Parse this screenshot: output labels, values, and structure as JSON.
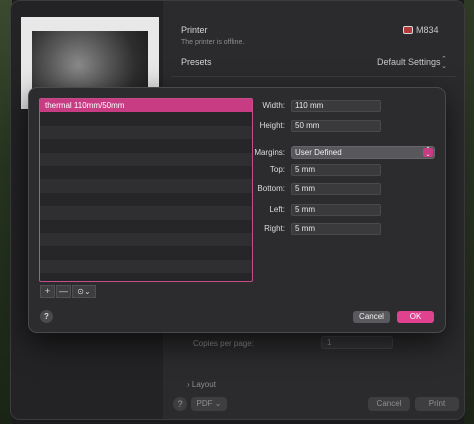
{
  "print_dialog": {
    "printer_label": "Printer",
    "printer_status": "The printer is offline.",
    "printer_name": "M834",
    "presets_label": "Presets",
    "presets_value": "Default Settings",
    "copies_per_page_label": "Copies per page:",
    "copies_per_page_value": "1",
    "layout_label": "Layout",
    "pdf_label": "PDF",
    "cancel_label": "Cancel",
    "print_label": "Print",
    "help_label": "?"
  },
  "paper_sizes": {
    "items": [
      "thermal 110mm/50mm",
      "",
      "",
      "",
      "",
      "",
      "",
      "",
      "",
      "",
      "",
      "",
      ""
    ],
    "selected_index": 0,
    "add_label": "+",
    "remove_label": "—",
    "more_label": "⊙⌄"
  },
  "form": {
    "width_label": "Width:",
    "width_value": "110 mm",
    "height_label": "Height:",
    "height_value": "50 mm",
    "margins_label": "Margins:",
    "margins_value": "User Defined",
    "top_label": "Top:",
    "top_value": "5 mm",
    "bottom_label": "Bottom:",
    "bottom_value": "5 mm",
    "left_label": "Left:",
    "left_value": "5 mm",
    "right_label": "Right:",
    "right_value": "5 mm"
  },
  "sheet_buttons": {
    "help_label": "?",
    "cancel_label": "Cancel",
    "ok_label": "OK"
  },
  "colors": {
    "accent": "#e0428f",
    "selection": "#c73c83"
  }
}
